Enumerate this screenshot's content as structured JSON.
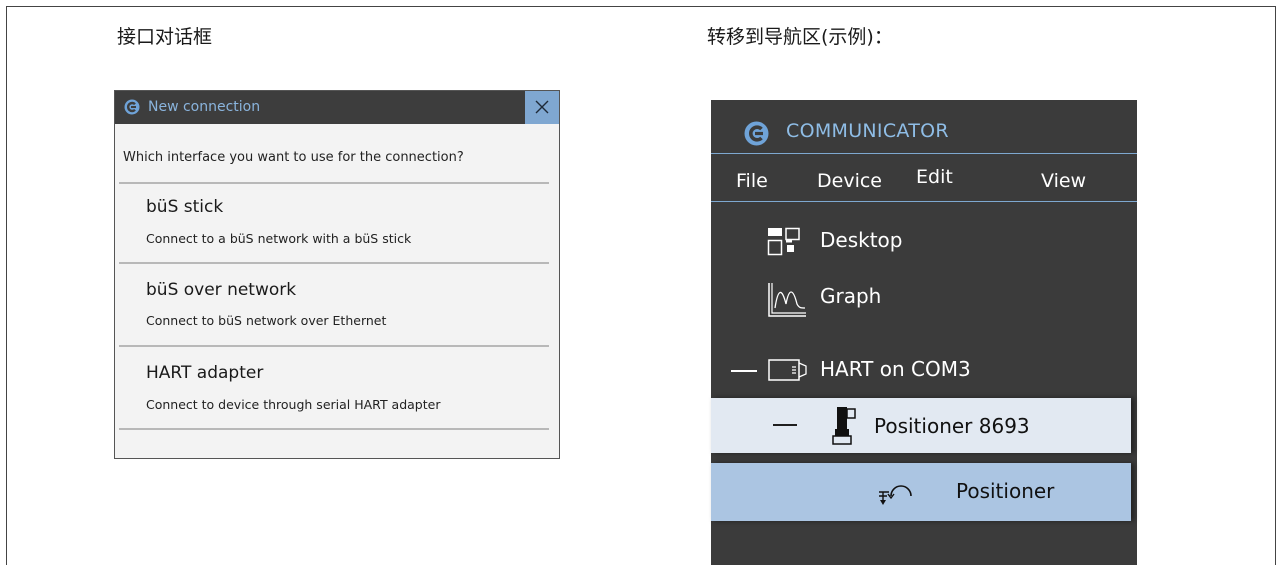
{
  "left_heading": "接口对话框",
  "right_heading": "转移到导航区(示例)：",
  "dialog": {
    "title": "New connection",
    "prompt": "Which interface you want to use for the connection?",
    "options": [
      {
        "title": "büS stick",
        "description": "Connect to a büS network with a büS stick"
      },
      {
        "title": "büS over network",
        "description": "Connect to büS network over Ethernet"
      },
      {
        "title": "HART adapter",
        "description": "Connect to device through serial HART adapter"
      }
    ]
  },
  "communicator": {
    "app_title": "COMMUNICATOR",
    "menu": [
      "File",
      "Device",
      "Edit",
      "View"
    ],
    "nav": {
      "desktop": "Desktop",
      "graph": "Graph",
      "hart": "HART on COM3",
      "positioner_device": "Positioner 8693",
      "positioner": "Positioner"
    }
  },
  "colors": {
    "dialog_title_bar": "#3d3d3d",
    "dialog_close": "#7fa7d1",
    "accent_text": "#8ab4dd",
    "panel_background": "#3b3b3b",
    "selected_row": "#abc5e2",
    "hover_row": "#e2e9f2"
  },
  "icons": [
    "communicator-logo-icon",
    "close-icon",
    "desktop-icon",
    "graph-icon",
    "interface-icon",
    "device-icon",
    "process-icon"
  ]
}
